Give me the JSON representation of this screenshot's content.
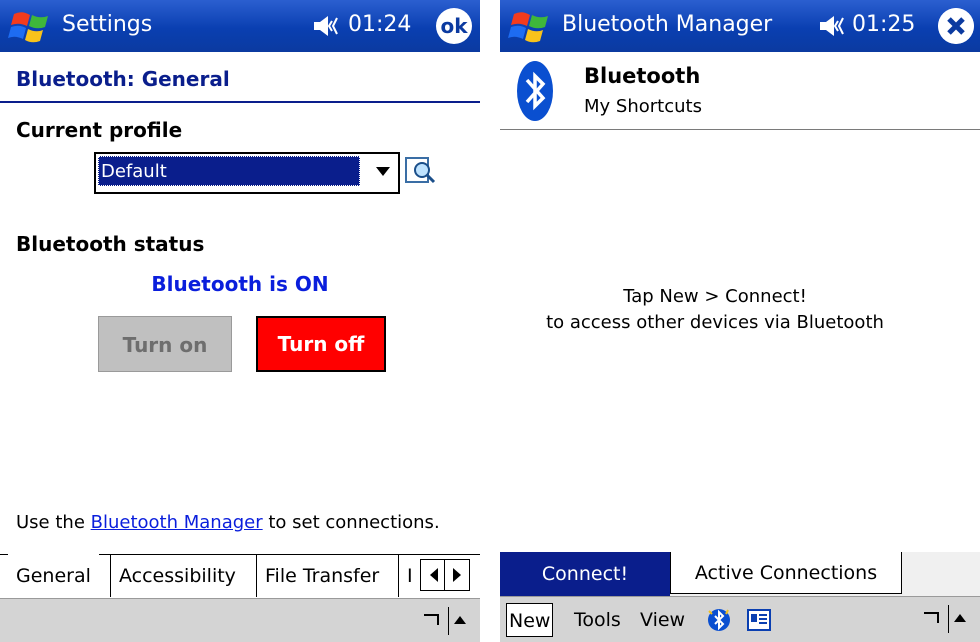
{
  "left": {
    "titlebar": {
      "title": "Settings",
      "time": "01:24",
      "ok_label": "ok"
    },
    "page_title": "Bluetooth: General",
    "current_profile_label": "Current profile",
    "profile_select": {
      "value": "Default"
    },
    "status_heading": "Bluetooth status",
    "status_text": "Bluetooth is ON",
    "buttons": {
      "turn_on": "Turn on",
      "turn_off": "Turn off"
    },
    "footer": {
      "prefix": "Use the ",
      "link": "Bluetooth Manager",
      "suffix": " to set connections."
    },
    "tabs": [
      {
        "label": "General",
        "active": true
      },
      {
        "label": "Accessibility",
        "active": false
      },
      {
        "label": "File Transfer",
        "active": false
      },
      {
        "label": "I",
        "active": false
      }
    ]
  },
  "right": {
    "titlebar": {
      "title": "Bluetooth Manager",
      "time": "01:25"
    },
    "header": {
      "title": "Bluetooth",
      "subtitle": "My Shortcuts"
    },
    "message": {
      "line1": "Tap New > Connect!",
      "line2": "to access other devices via Bluetooth"
    },
    "tabs": [
      {
        "label": "Connect!",
        "active": true
      },
      {
        "label": "Active Connections",
        "active": false
      }
    ],
    "menu": {
      "new": "New",
      "tools": "Tools",
      "view": "View"
    }
  },
  "colors": {
    "titlebar": "#0b3aa0",
    "heading": "#0a1e8c",
    "status": "#0a1edc",
    "turn_off": "#ff0000"
  },
  "icons": [
    "windows-start-icon",
    "speaker-icon",
    "ok-icon",
    "close-icon",
    "profile-lookup-icon",
    "bluetooth-logo-icon",
    "bluetooth-icon",
    "contact-card-icon",
    "keyboard-sip-icon"
  ]
}
